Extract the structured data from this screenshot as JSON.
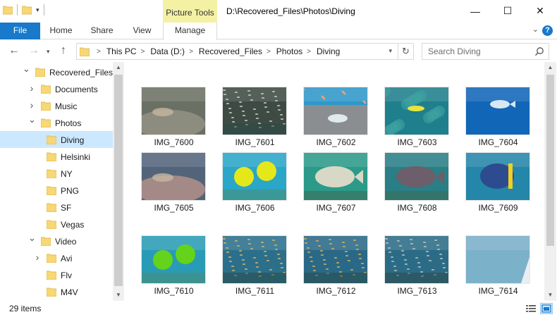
{
  "window": {
    "title": "D:\\Recovered_Files\\Photos\\Diving",
    "context_tab": "Picture Tools",
    "minimize": "—",
    "maximize": "☐",
    "close": "✕"
  },
  "ribbon": {
    "tabs": [
      "File",
      "Home",
      "Share",
      "View",
      "Manage"
    ],
    "help": "?"
  },
  "address": {
    "crumbs": [
      "This PC",
      "Data (D:)",
      "Recovered_Files",
      "Photos",
      "Diving"
    ]
  },
  "search": {
    "placeholder": "Search Diving"
  },
  "tree": [
    {
      "label": "Recovered_Files",
      "arrow": "expanded",
      "level": 0
    },
    {
      "label": "Documents",
      "arrow": "collapsed",
      "level": 1
    },
    {
      "label": "Music",
      "arrow": "collapsed",
      "level": 1
    },
    {
      "label": "Photos",
      "arrow": "expanded",
      "level": 1
    },
    {
      "label": "Diving",
      "arrow": "none",
      "level": 2,
      "selected": true
    },
    {
      "label": "Helsinki",
      "arrow": "none",
      "level": 2
    },
    {
      "label": "NY",
      "arrow": "none",
      "level": 2
    },
    {
      "label": "PNG",
      "arrow": "none",
      "level": 2
    },
    {
      "label": "SF",
      "arrow": "none",
      "level": 2
    },
    {
      "label": "Vegas",
      "arrow": "none",
      "level": 2
    },
    {
      "label": "Video",
      "arrow": "expanded",
      "level": 1
    },
    {
      "label": "Avi",
      "arrow": "collapsed",
      "level": 2
    },
    {
      "label": "Flv",
      "arrow": "none",
      "level": 2
    },
    {
      "label": "M4V",
      "arrow": "none",
      "level": 2
    }
  ],
  "files": [
    {
      "name": "IMG_7600",
      "bg": "#6b7064",
      "fg": "#9a9a8a",
      "motif": "rock"
    },
    {
      "name": "IMG_7601",
      "bg": "#3e4a44",
      "fg": "#c8ccc0",
      "motif": "school"
    },
    {
      "name": "IMG_7602",
      "bg": "#2f98c9",
      "fg": "#c9876b",
      "motif": "reef"
    },
    {
      "name": "IMG_7603",
      "bg": "#1f7f8c",
      "fg": "#e7e43f",
      "motif": "coral"
    },
    {
      "name": "IMG_7604",
      "bg": "#1166b8",
      "fg": "#d9e7f2",
      "motif": "fish"
    },
    {
      "name": "IMG_7605",
      "bg": "#53647a",
      "fg": "#c89a8c",
      "motif": "rock"
    },
    {
      "name": "IMG_7606",
      "bg": "#2aa6c8",
      "fg": "#e4e81b",
      "motif": "twofish"
    },
    {
      "name": "IMG_7607",
      "bg": "#2c9a89",
      "fg": "#d7d9c6",
      "motif": "bigfish"
    },
    {
      "name": "IMG_7608",
      "bg": "#2a7f86",
      "fg": "#6c5e6a",
      "motif": "bigfish"
    },
    {
      "name": "IMG_7609",
      "bg": "#2486a8",
      "fg": "#2c4c8f",
      "motif": "angel"
    },
    {
      "name": "IMG_7610",
      "bg": "#2a9bb6",
      "fg": "#64d31b",
      "motif": "twofish"
    },
    {
      "name": "IMG_7611",
      "bg": "#2b6f8b",
      "fg": "#d5b466",
      "motif": "school"
    },
    {
      "name": "IMG_7612",
      "bg": "#2a6887",
      "fg": "#d8b058",
      "motif": "school"
    },
    {
      "name": "IMG_7613",
      "bg": "#2c6b86",
      "fg": "#b7c4c2",
      "motif": "school"
    },
    {
      "name": "IMG_7614",
      "bg": "#5a9dbc",
      "fg": "#bcd8e6",
      "motif": "water"
    }
  ],
  "status": {
    "item_count": "29 items"
  },
  "colors": {
    "accent": "#1979ca",
    "selection": "#cce8ff",
    "context_tab": "#f5f1a4",
    "folder": "#f8d775"
  }
}
